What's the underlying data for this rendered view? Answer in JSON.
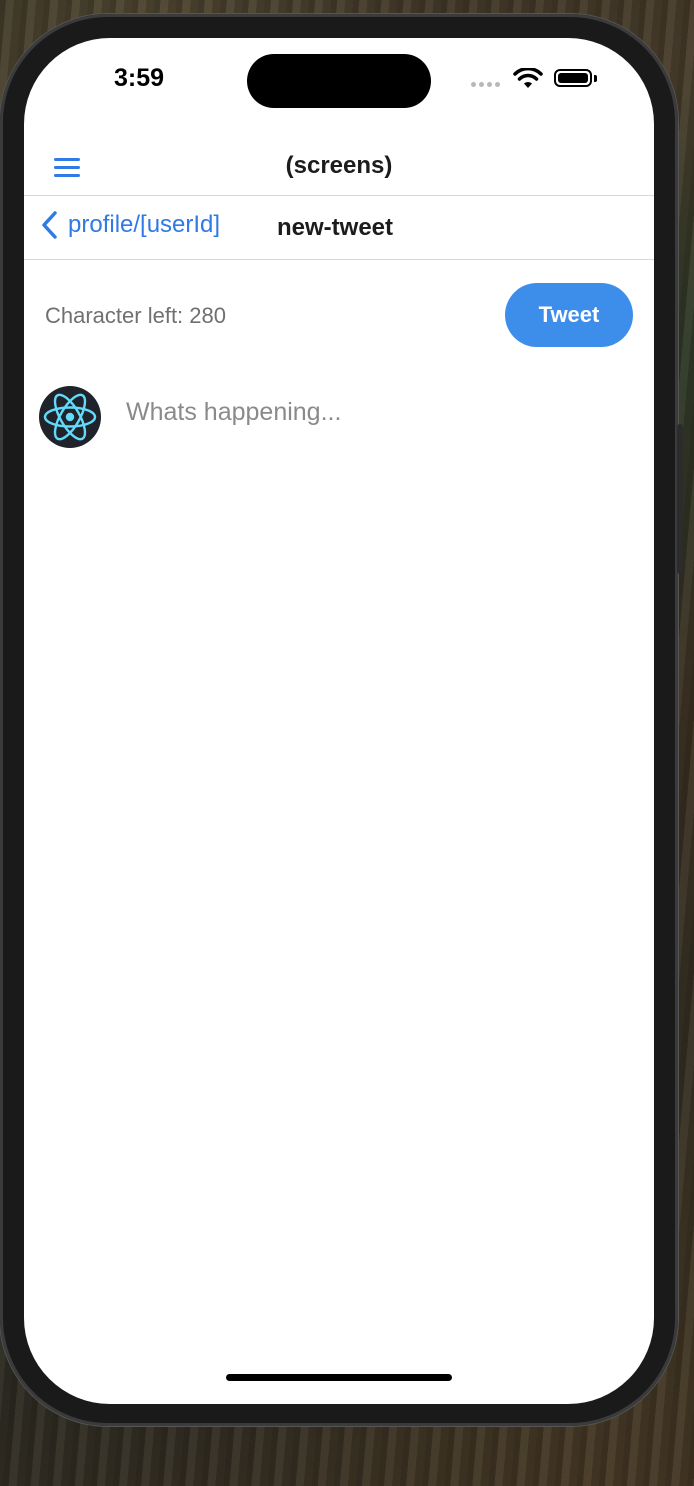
{
  "status_bar": {
    "time": "3:59"
  },
  "header": {
    "title": "(screens)",
    "menu_icon": "hamburger-menu-icon"
  },
  "nav": {
    "back_label": "profile/[userId]",
    "back_icon": "chevron-left-icon",
    "title": "new-tweet"
  },
  "compose": {
    "char_left": "Character left: 280",
    "tweet_button": "Tweet",
    "placeholder": "Whats happening...",
    "avatar_icon": "react-logo-icon"
  },
  "colors": {
    "accent": "#2f7ae5",
    "tweet_button": "#3d8eea"
  }
}
